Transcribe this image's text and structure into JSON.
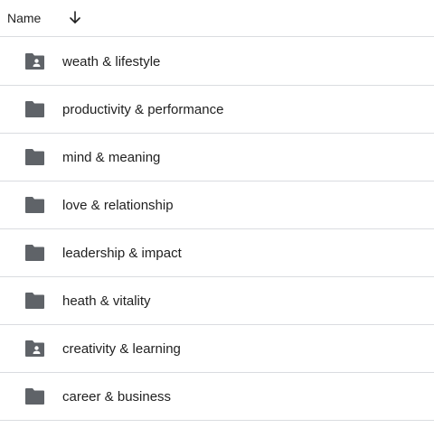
{
  "header": {
    "name_label": "Name",
    "sort_icon": "arrow-down-icon"
  },
  "items": [
    {
      "label": "weath & lifestyle",
      "icon": "shared-folder-icon"
    },
    {
      "label": "productivity & performance",
      "icon": "folder-icon"
    },
    {
      "label": "mind & meaning",
      "icon": "folder-icon"
    },
    {
      "label": "love & relationship",
      "icon": "folder-icon"
    },
    {
      "label": "leadership & impact",
      "icon": "folder-icon"
    },
    {
      "label": "heath & vitality",
      "icon": "folder-icon"
    },
    {
      "label": "creativity & learning",
      "icon": "shared-folder-icon"
    },
    {
      "label": "career & business",
      "icon": "folder-icon"
    }
  ],
  "colors": {
    "folder": "#5f6368",
    "divider": "#dadce0",
    "text": "#1f1f1f"
  }
}
